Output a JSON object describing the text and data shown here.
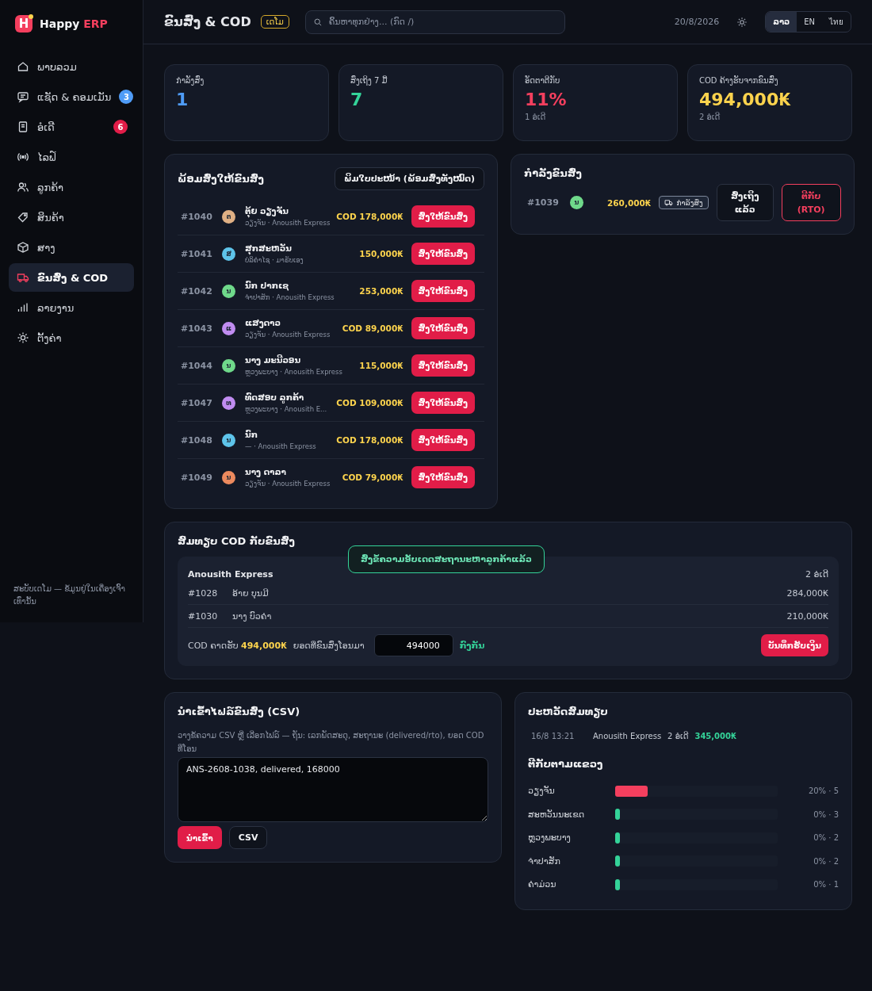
{
  "brand": {
    "mark": "H",
    "name": "Happy",
    "accent": "ERP"
  },
  "sidebar": {
    "items": [
      {
        "label": "ພາບລວມ",
        "selected": false
      },
      {
        "label": "ແຊັດ & ຄອມເມັນ",
        "selected": false,
        "badge": {
          "text": "3",
          "color": "#4f9cf7"
        }
      },
      {
        "label": "ອໍເດີ",
        "selected": false,
        "badge": {
          "text": "6",
          "color": "#e11d48"
        }
      },
      {
        "label": "ໄລຟ໌",
        "selected": false
      },
      {
        "label": "ລູກຄ້າ",
        "selected": false
      },
      {
        "label": "ສິນຄ້າ",
        "selected": false
      },
      {
        "label": "ສາງ",
        "selected": false
      },
      {
        "label": "ຂົນສົ່ງ & COD",
        "selected": true
      },
      {
        "label": "ລາຍງານ",
        "selected": false
      },
      {
        "label": "ຕັ້ງຄ່າ",
        "selected": false
      }
    ],
    "footer": "ສະບັບເດໂມ — ຂໍ້ມູນຢູ່ໃນເຄື່ອງເຈົ້າເທົ່ານັ້ນ"
  },
  "header": {
    "title": "ຂົນສົ່ງ & COD",
    "badge": "ເດໂມ",
    "search": {
      "placeholder": "ຄົ້ນຫາທຸກຢ່າງ... (ກົດ /)"
    },
    "date": "20/8/2026",
    "languages": [
      {
        "label": "ລາວ",
        "selected": true
      },
      {
        "label": "EN",
        "selected": false
      },
      {
        "label": "ไทย",
        "selected": false
      }
    ]
  },
  "stats": [
    {
      "label": "ກຳລັງສົ່ງ",
      "value": "1",
      "color": "#4f9cf7"
    },
    {
      "label": "ສົ່ງເຖິງ 7 ມື້",
      "value": "7",
      "color": "#34d399"
    },
    {
      "label": "ອັດຕາຕີກັບ",
      "value": "11%",
      "color": "#f43f5e",
      "note": "1 ອໍເດີ"
    },
    {
      "label": "COD ຄ້າງຮັບຈາກຂົນສົ່ງ",
      "value": "494,000₭",
      "color": "#fcd34d",
      "note": "2 ອໍເດີ"
    }
  ],
  "ready": {
    "title": "ພ້ອມສົ່ງໃຫ້ຂົນສົ່ງ",
    "print_button": "ພິມໃບປະໜ້າ (ພ້ອມສົ່ງທັງໝົດ)",
    "rows": [
      {
        "id": "#1040",
        "initial": "ຕ",
        "color": "#e0b084",
        "name": "ຕຸ້ຍ ວຽງຈັນ",
        "sub": "ວຽງຈັນ · Anousith Express",
        "amount": "COD 178,000₭",
        "action": "ສົ່ງໃຫ້ຂົນສົ່ງ"
      },
      {
        "id": "#1041",
        "initial": "ສ",
        "color": "#5ec4ea",
        "name": "ສຸກສະຫວັນ",
        "sub": "ບໍລິຄຳໄຊ · ມາຮັບເອງ",
        "amount": "150,000₭",
        "action": "ສົ່ງໃຫ້ຂົນສົ່ງ"
      },
      {
        "id": "#1042",
        "initial": "ນ",
        "color": "#6fd98a",
        "name": "ນົກ ປາກເຊ",
        "sub": "ຈຳປາສັກ · Anousith Express",
        "amount": "253,000₭",
        "action": "ສົ່ງໃຫ້ຂົນສົ່ງ"
      },
      {
        "id": "#1043",
        "initial": "ແ",
        "color": "#c08cf0",
        "name": "ແສງດາວ",
        "sub": "ວຽງຈັນ · Anousith Express",
        "amount": "COD 89,000₭",
        "action": "ສົ່ງໃຫ້ຂົນສົ່ງ"
      },
      {
        "id": "#1044",
        "initial": "ນ",
        "color": "#6fd98a",
        "name": "ນາງ ມະນີວອນ",
        "sub": "ຫຼວງພະບາງ · Anousith Express",
        "amount": "115,000₭",
        "action": "ສົ່ງໃຫ້ຂົນສົ່ງ"
      },
      {
        "id": "#1047",
        "initial": "ທ",
        "color": "#c08cf0",
        "name": "ທົດສອບ ລູກຄ້າ",
        "sub": "ຫຼວງພະບາງ · Anousith E...",
        "amount": "COD 109,000₭",
        "action": "ສົ່ງໃຫ້ຂົນສົ່ງ"
      },
      {
        "id": "#1048",
        "initial": "ນ",
        "color": "#5ec4ea",
        "name": "ນົກ",
        "sub": "— · Anousith Express",
        "amount": "COD 178,000₭",
        "action": "ສົ່ງໃຫ້ຂົນສົ່ງ"
      },
      {
        "id": "#1049",
        "initial": "ນ",
        "color": "#ec8a5e",
        "name": "ນາງ ດາລາ",
        "sub": "ວຽງຈັນ · Anousith Express",
        "amount": "COD 79,000₭",
        "action": "ສົ່ງໃຫ້ຂົນສົ່ງ"
      }
    ]
  },
  "transit": {
    "title": "ກຳລັງຂົນສົ່ງ",
    "rows": [
      {
        "id": "#1039",
        "initial": "ນ",
        "color": "#6fd98a",
        "amount": "260,000₭",
        "status": "ກຳລັງສົ່ງ",
        "delivered_button": "ສົ່ງເຖິງແລ້ວ",
        "rto_button": "ຕີກັບ (RTO)"
      }
    ]
  },
  "reconcile": {
    "title": "ສົມທຽບ COD ກັບຂົນສົ່ງ",
    "toast": "ສົ່ງຂໍ້ຄວາມອັບເດດສະຖານະຫາລູກຄ້າແລ້ວ",
    "group": {
      "carrier": "Anousith Express",
      "count": "2 ອໍເດີ",
      "rows": [
        {
          "id": "#1028",
          "name": "ອ້າຍ ບຸນມີ",
          "amount": "284,000₭"
        },
        {
          "id": "#1030",
          "name": "ນາງ ບົວຄຳ",
          "amount": "210,000₭"
        }
      ],
      "expected_label": "COD ຄາດຮັບ",
      "expected": "494,000₭",
      "transferred_label": "ຍອດທີ່ຂົນສົ່ງໂອນມາ",
      "transferred": "494000",
      "match": "ກົງກັນ",
      "save_button": "ບັນທຶກຮັບເງິນ"
    }
  },
  "import": {
    "title": "ນຳເຂົ້າໄຟລ໌ຂົນສົ່ງ (CSV)",
    "hint": "ວາງຂໍ້ຄວາມ CSV ຫຼື ເລືອກໄຟລ໌ — ຖັນ: ເລກພັດສະດຸ, ສະຖານະ (delivered/rto), ຍອດ COD ທີ່ໂອນ",
    "value": "ANS-2608-1038, delivered, 168000",
    "import_button": "ນຳເຂົ້າ",
    "file_button": "CSV"
  },
  "history": {
    "title": "ປະຫວັດສົມທຽບ",
    "rows": [
      {
        "time": "16/8 13:21",
        "carrier": "Anousith Express",
        "count": "2 ອໍເດີ",
        "amount": "345,000₭"
      }
    ]
  },
  "returns": {
    "title": "ຕີກັບຕາມແຂວງ",
    "rows": [
      {
        "province": "ວຽງຈັນ",
        "level": 0.2,
        "color": "#f43f5e",
        "reading": "20% · 5"
      },
      {
        "province": "ສະຫວັນນະເຂດ",
        "level": 0,
        "color": "#34d399",
        "reading": "0% · 3"
      },
      {
        "province": "ຫຼວງພະບາງ",
        "level": 0,
        "color": "#34d399",
        "reading": "0% · 2"
      },
      {
        "province": "ຈຳປາສັກ",
        "level": 0,
        "color": "#34d399",
        "reading": "0% · 2"
      },
      {
        "province": "ຄຳມ່ວນ",
        "level": 0,
        "color": "#34d399",
        "reading": "0% · 1"
      }
    ]
  }
}
